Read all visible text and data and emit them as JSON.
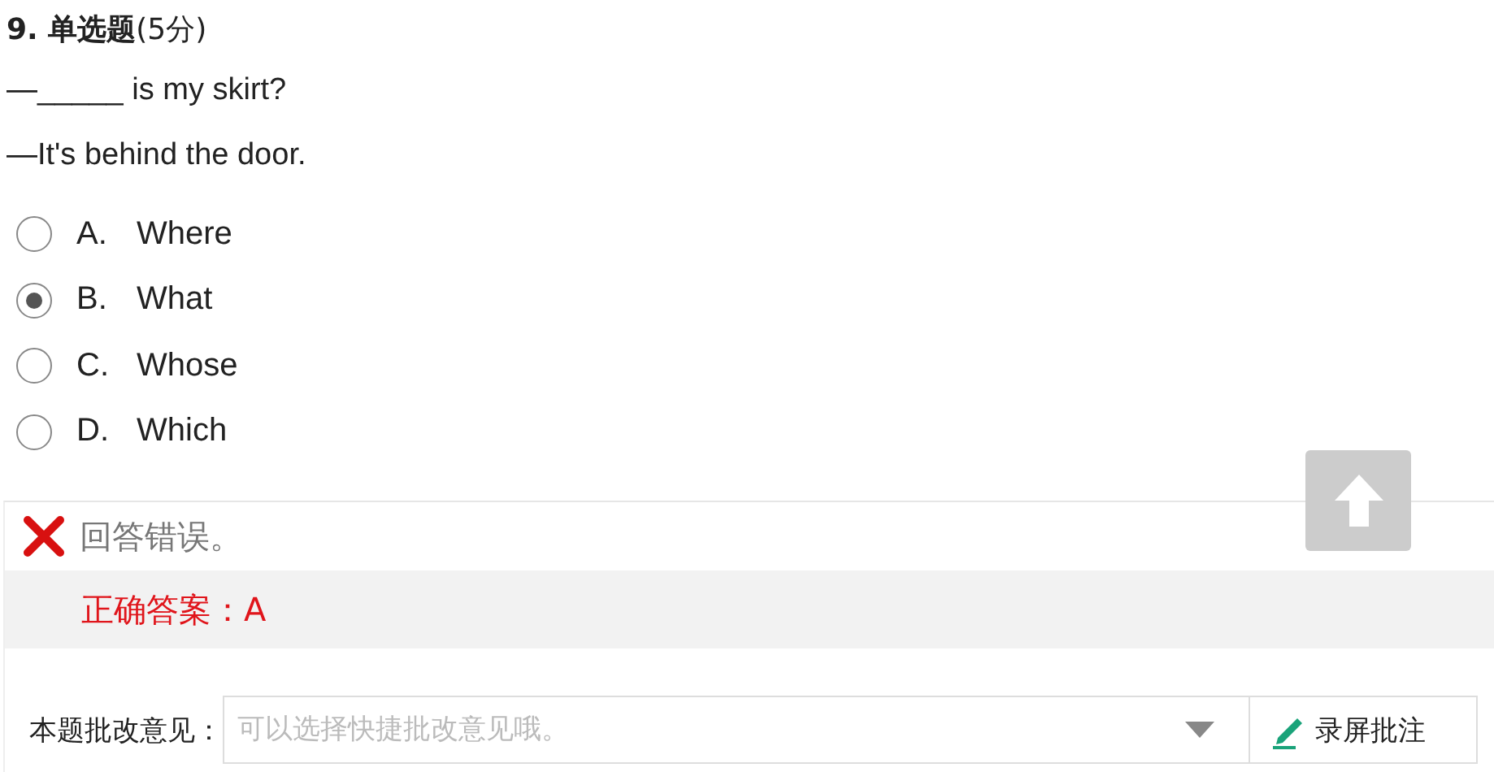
{
  "question": {
    "title": "**9. 单选题**(5分)",
    "lines": [
      "—_____ is my skirt?",
      "—It's behind the door."
    ]
  },
  "options": [
    {
      "letter": "A.",
      "text": "Where",
      "selected": false
    },
    {
      "letter": "B.",
      "text": "What",
      "selected": true
    },
    {
      "letter": "C.",
      "text": "Whose",
      "selected": false
    },
    {
      "letter": "D.",
      "text": "Which",
      "selected": false
    }
  ],
  "result": {
    "kind": "wrong",
    "message": "回答错误。",
    "answer": "正确答案：A"
  },
  "comment": {
    "label": "本题批改意见：",
    "placeholder": "可以选择快捷批改意见哦。",
    "button": "录屏批注"
  }
}
